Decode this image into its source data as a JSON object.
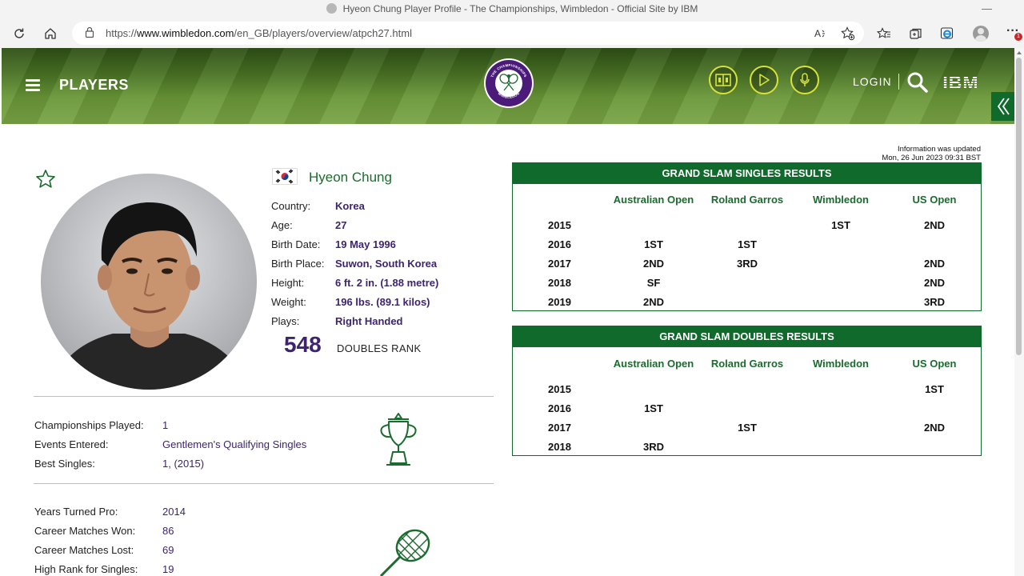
{
  "browser": {
    "window_title": "Hyeon Chung Player Profile - The Championships, Wimbledon - Official Site by IBM",
    "url_prefix": "https://",
    "url_domain": "www.wimbledon.com",
    "url_path": "/en_GB/players/overview/atpch27.html",
    "notification_count": "1"
  },
  "header": {
    "section_title": "PLAYERS",
    "login_label": "LOGIN",
    "logo_text": "IBM",
    "logo_top": "THE CHAMPIONSHIPS",
    "logo_bottom": "WIMBLEDON"
  },
  "player": {
    "name": "Hyeon Chung",
    "bio": [
      {
        "label": "Country:",
        "value": "Korea"
      },
      {
        "label": "Age:",
        "value": "27"
      },
      {
        "label": "Birth Date:",
        "value": "19 May 1996"
      },
      {
        "label": "Birth Place:",
        "value": "Suwon, South Korea"
      },
      {
        "label": "Height:",
        "value": "6 ft. 2 in. (1.88 metre)"
      },
      {
        "label": "Weight:",
        "value": "196 lbs. (89.1 kilos)"
      },
      {
        "label": "Plays:",
        "value": "Right Handed"
      }
    ],
    "rank_value": "548",
    "rank_label": "DOUBLES RANK"
  },
  "championship_stats": [
    {
      "label": "Championships Played:",
      "value": "1"
    },
    {
      "label": "Events Entered:",
      "value": "Gentlemen's Qualifying Singles"
    },
    {
      "label": "Best Singles:",
      "value": "1, (2015)"
    }
  ],
  "career_stats": [
    {
      "label": "Years Turned Pro:",
      "value": "2014"
    },
    {
      "label": "Career Matches Won:",
      "value": "86"
    },
    {
      "label": "Career Matches Lost:",
      "value": "69"
    },
    {
      "label": "High Rank for Singles:",
      "value": "19"
    }
  ],
  "updated_note": {
    "line1": "Information was updated",
    "line2": "Mon, 26 Jun 2023 09:31 BST"
  },
  "singles_results": {
    "title": "GRAND SLAM SINGLES RESULTS",
    "columns": [
      "Australian Open",
      "Roland Garros",
      "Wimbledon",
      "US Open"
    ],
    "rows": [
      {
        "year": "2015",
        "cells": [
          "",
          "",
          "1ST",
          "2ND"
        ]
      },
      {
        "year": "2016",
        "cells": [
          "1ST",
          "1ST",
          "",
          ""
        ]
      },
      {
        "year": "2017",
        "cells": [
          "2ND",
          "3RD",
          "",
          "2ND"
        ]
      },
      {
        "year": "2018",
        "cells": [
          "SF",
          "",
          "",
          "2ND"
        ]
      },
      {
        "year": "2019",
        "cells": [
          "2ND",
          "",
          "",
          "3RD"
        ]
      }
    ]
  },
  "doubles_results": {
    "title": "GRAND SLAM DOUBLES RESULTS",
    "columns": [
      "Australian Open",
      "Roland Garros",
      "Wimbledon",
      "US Open"
    ],
    "rows": [
      {
        "year": "2015",
        "cells": [
          "",
          "",
          "",
          "1ST"
        ]
      },
      {
        "year": "2016",
        "cells": [
          "1ST",
          "",
          "",
          ""
        ]
      },
      {
        "year": "2017",
        "cells": [
          "",
          "1ST",
          "",
          "2ND"
        ]
      },
      {
        "year": "2018",
        "cells": [
          "3RD",
          "",
          "",
          ""
        ]
      }
    ]
  },
  "colors": {
    "brand_green": "#0f6a2c",
    "brand_purple": "#3e2470",
    "accent_yellow": "#d7e23a"
  }
}
